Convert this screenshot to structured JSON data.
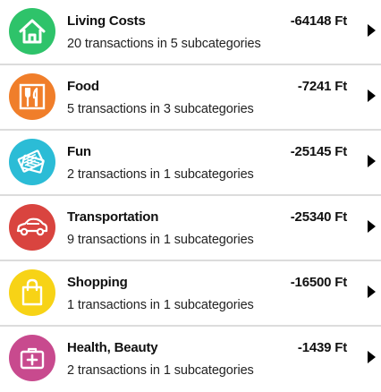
{
  "categories": [
    {
      "title": "Living Costs",
      "subtitle": "20 transactions in 5 subcategories",
      "amount": "-64148 Ft",
      "icon": "home-icon",
      "color": "#2ec36a"
    },
    {
      "title": "Food",
      "subtitle": "5 transactions in 3 subcategories",
      "amount": "-7241 Ft",
      "icon": "cutlery-icon",
      "color": "#f07e2a"
    },
    {
      "title": "Fun",
      "subtitle": "2 transactions in 1 subcategories",
      "amount": "-25145 Ft",
      "icon": "tickets-icon",
      "color": "#2bbcd6"
    },
    {
      "title": "Transportation",
      "subtitle": "9 transactions in 1 subcategories",
      "amount": "-25340 Ft",
      "icon": "car-icon",
      "color": "#d9443f"
    },
    {
      "title": "Shopping",
      "subtitle": "1 transactions in 1 subcategories",
      "amount": "-16500 Ft",
      "icon": "shopping-bag-icon",
      "color": "#f7d316"
    },
    {
      "title": "Health, Beauty",
      "subtitle": "2 transactions in 1 subcategories",
      "amount": "-1439 Ft",
      "icon": "first-aid-kit-icon",
      "color": "#c84a8e"
    }
  ]
}
